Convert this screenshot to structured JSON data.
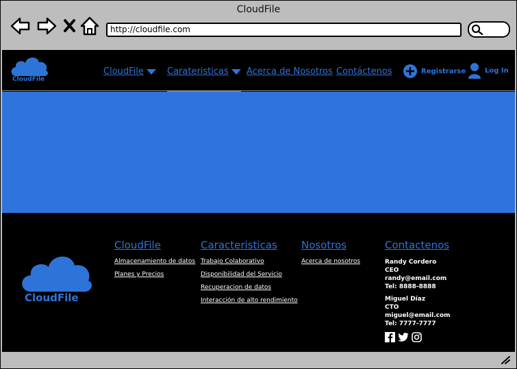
{
  "window": {
    "title": "CloudFile"
  },
  "browser": {
    "url": "http://cloudfile.com"
  },
  "brand": {
    "name": "CloudFile",
    "color": "#2e74d8"
  },
  "nav": {
    "items": [
      {
        "label": "CloudFile",
        "dropdown": true
      },
      {
        "label": "Carateristicas",
        "dropdown": true
      },
      {
        "label": "Acerca de Nosotros",
        "dropdown": false
      },
      {
        "label": "Contáctenos",
        "dropdown": false
      }
    ],
    "register_label": "Registrarse",
    "login_label": "Log In"
  },
  "hero": {
    "color": "#2f74dc"
  },
  "footer": {
    "cloudfile": {
      "title": "CloudFile",
      "links": [
        "Almacenamiento de datos",
        "Planes y Precios"
      ]
    },
    "caracteristicas": {
      "title": "Caracteristicas",
      "links": [
        "Trabajo Colaborativo",
        "Disponibilidad del Servicio",
        "Recuperacion de datos",
        "Interacción de alto rendimiento"
      ]
    },
    "nosotros": {
      "title": "Nosotros",
      "links": [
        "Acerca de nosotros"
      ]
    },
    "contactenos": {
      "title": "Contactenos",
      "contacts": [
        {
          "name": "Randy Cordero",
          "role": "CEO",
          "email": "randy@email.com",
          "tel": "Tel: 8888-8888"
        },
        {
          "name": "Miguel Díaz",
          "role": "CTO",
          "email": "miguel@email.com",
          "tel": "Tel: 7777-7777"
        }
      ],
      "social_icons": [
        "facebook-icon",
        "twitter-icon",
        "instagram-icon"
      ]
    }
  }
}
